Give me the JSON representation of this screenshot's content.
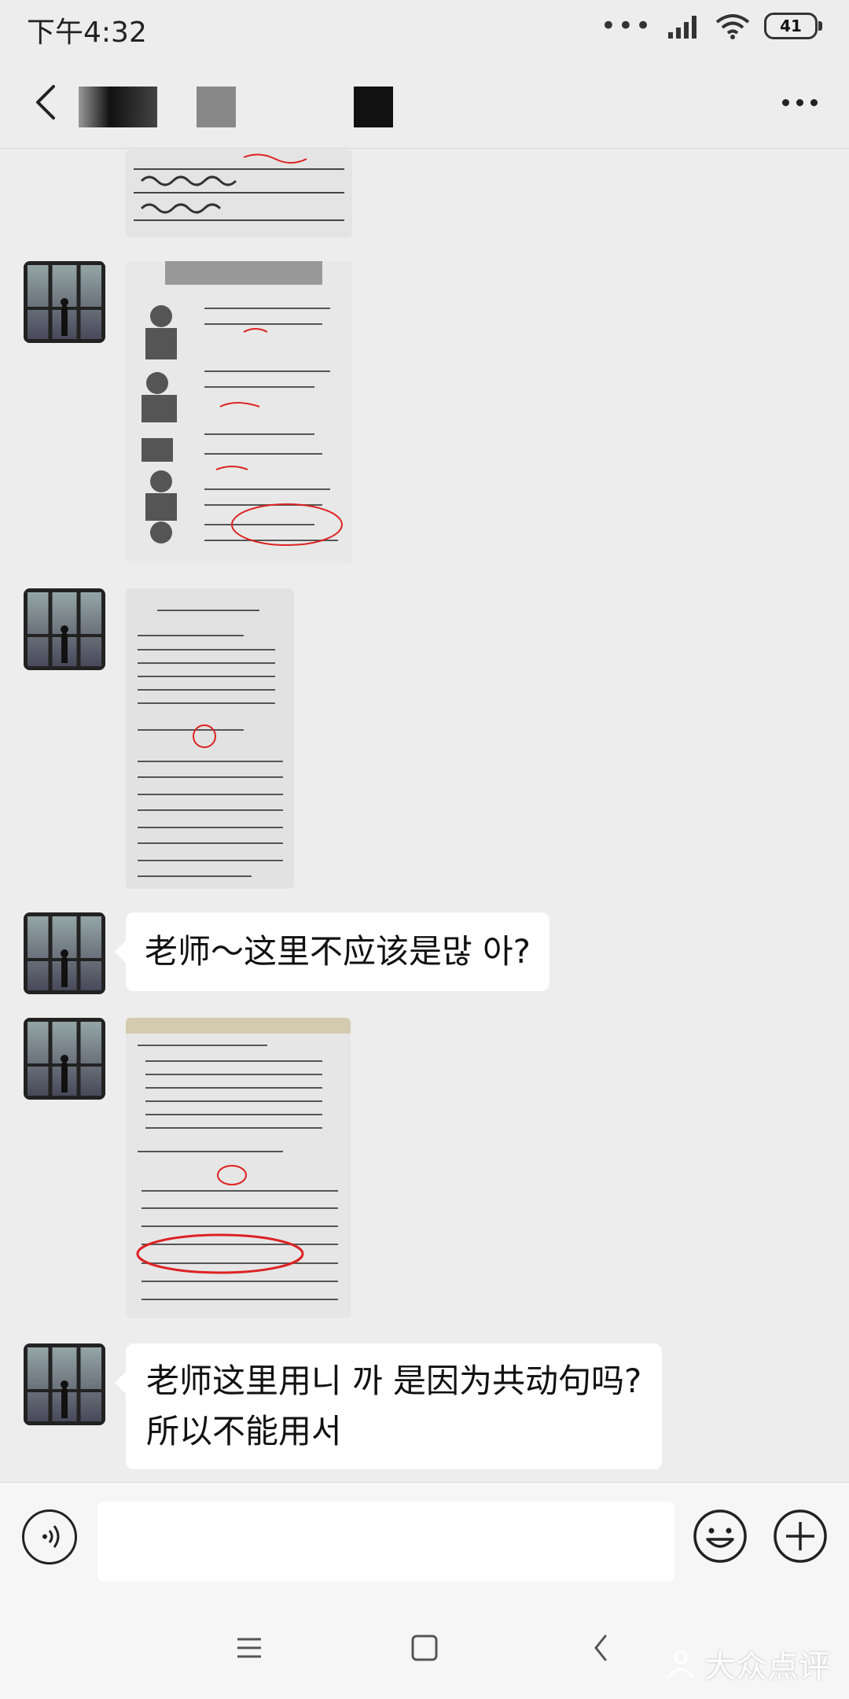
{
  "status_bar": {
    "time": "下午4:32",
    "battery": "41"
  },
  "header": {
    "title": ""
  },
  "messages": [
    {
      "type": "image",
      "content": "worksheet photo (partial, scrolled)"
    },
    {
      "type": "image",
      "content": "worksheet photo with illustrations"
    },
    {
      "type": "image",
      "content": "worksheet photo"
    },
    {
      "type": "text",
      "text": "老师～这里不应该是많 아?"
    },
    {
      "type": "image",
      "content": "worksheet photo with red circle"
    },
    {
      "type": "text",
      "lines": [
        "老师这里用니 까 是因为共动句吗?",
        "所以不能用서"
      ]
    }
  ],
  "input": {
    "placeholder": ""
  },
  "watermark": "大众点评",
  "icons": {
    "back": "back-arrow-icon",
    "more": "more-dots-icon",
    "voice": "voice-icon",
    "emoji": "emoji-icon",
    "plus": "plus-icon",
    "menu": "menu-icon",
    "home": "home-square-icon",
    "nav_back": "nav-back-icon"
  }
}
